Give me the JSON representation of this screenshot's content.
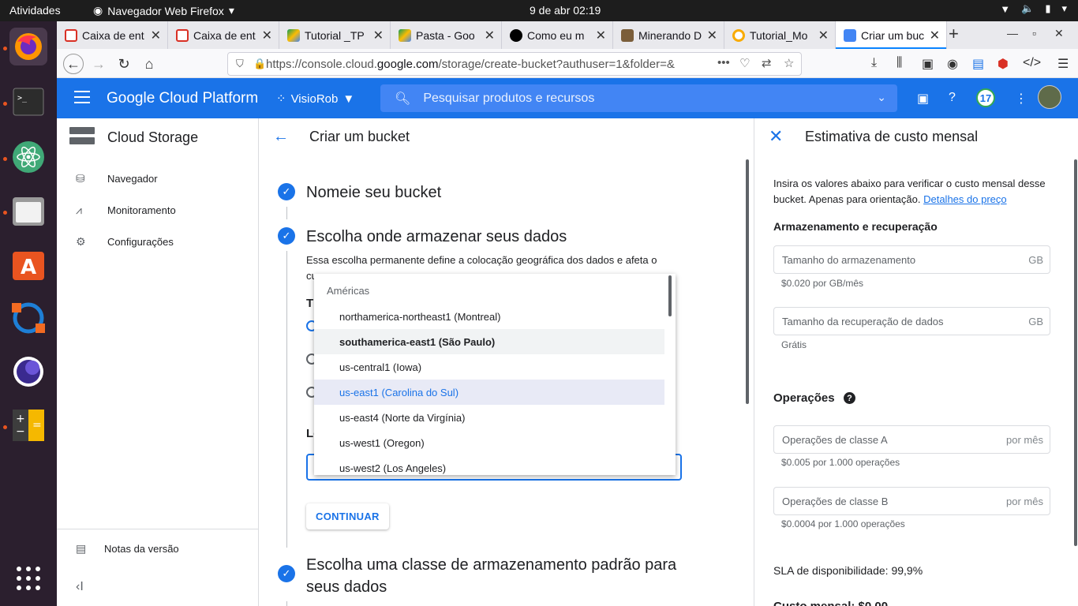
{
  "os": {
    "activities": "Atividades",
    "app_name": "Navegador Web Firefox",
    "clock": "9 de abr  02:19"
  },
  "browser": {
    "tabs": [
      {
        "title": "Caixa de ent",
        "icon": "gmail-icon",
        "color": "#d93025"
      },
      {
        "title": "Caixa de ent",
        "icon": "gmail-icon",
        "color": "#d93025"
      },
      {
        "title": "Tutorial _TP",
        "icon": "drive-icon",
        "color": "#fbbc04"
      },
      {
        "title": "Pasta - Goo",
        "icon": "drive-icon",
        "color": "#34a853"
      },
      {
        "title": "Como eu m",
        "icon": "medium-icon",
        "color": "#000000"
      },
      {
        "title": "Minerando D",
        "icon": "site-icon",
        "color": "#7b5e3a"
      },
      {
        "title": "Tutorial_Mo",
        "icon": "colab-icon",
        "color": "#f9ab00"
      },
      {
        "title": "Criar um buc",
        "icon": "gcp-icon",
        "color": "#4285f4"
      }
    ],
    "url_prefix": "https://console.cloud.",
    "url_domain": "google.com",
    "url_suffix": "/storage/create-bucket?authuser=1&folder=&"
  },
  "gcp": {
    "brand": "Google Cloud Platform",
    "project": "VisioRob",
    "search_placeholder": "Pesquisar produtos e recursos",
    "notifications_count": "17"
  },
  "sidebar": {
    "title": "Cloud Storage",
    "items": [
      {
        "label": "Navegador",
        "icon": "bucket-icon"
      },
      {
        "label": "Monitoramento",
        "icon": "chart-icon"
      },
      {
        "label": "Configurações",
        "icon": "gear-icon"
      }
    ],
    "release_notes": "Notas da versão"
  },
  "main": {
    "title": "Criar um bucket",
    "step1": "Nomeie seu bucket",
    "step2": "Escolha onde armazenar seus dados",
    "step2_desc_line1": "Essa escolha permanente define a colocação geográfica dos dados e afeta o",
    "step2_desc_line2": "cu",
    "type_label_fragment": "T",
    "location_label_fragment": "Lo",
    "continue": "CONTINUAR",
    "step3": "Escolha uma classe de armazenamento padrão para seus dados"
  },
  "dropdown": {
    "group": "Américas",
    "options": [
      "northamerica-northeast1 (Montreal)",
      "southamerica-east1 (São Paulo)",
      "us-central1 (Iowa)",
      "us-east1 (Carolina do Sul)",
      "us-east4 (Norte da Virgínia)",
      "us-west1 (Oregon)",
      "us-west2 (Los Angeles)"
    ],
    "hovered_index": 1,
    "selected_index": 3
  },
  "cost_panel": {
    "title": "Estimativa de custo mensal",
    "intro": "Insira os valores abaixo para verificar o custo mensal desse bucket. Apenas para orientação.",
    "price_link": "Detalhes do preço",
    "storage_heading": "Armazenamento e recuperação",
    "storage_field": "Tamanho do armazenamento",
    "storage_unit": "GB",
    "storage_hint": "$0.020 por GB/mês",
    "retrieval_field": "Tamanho da recuperação de dados",
    "retrieval_unit": "GB",
    "retrieval_hint": "Grátis",
    "ops_heading": "Operações",
    "class_a_field": "Operações de classe A",
    "class_a_unit": "por mês",
    "class_a_hint": "$0.005 por 1.000 operações",
    "class_b_field": "Operações de classe B",
    "class_b_unit": "por mês",
    "class_b_hint": "$0.0004 por 1.000 operações",
    "sla": "SLA de disponibilidade: 99,9%",
    "total_fragment": "Custo mensal: $0,00"
  }
}
